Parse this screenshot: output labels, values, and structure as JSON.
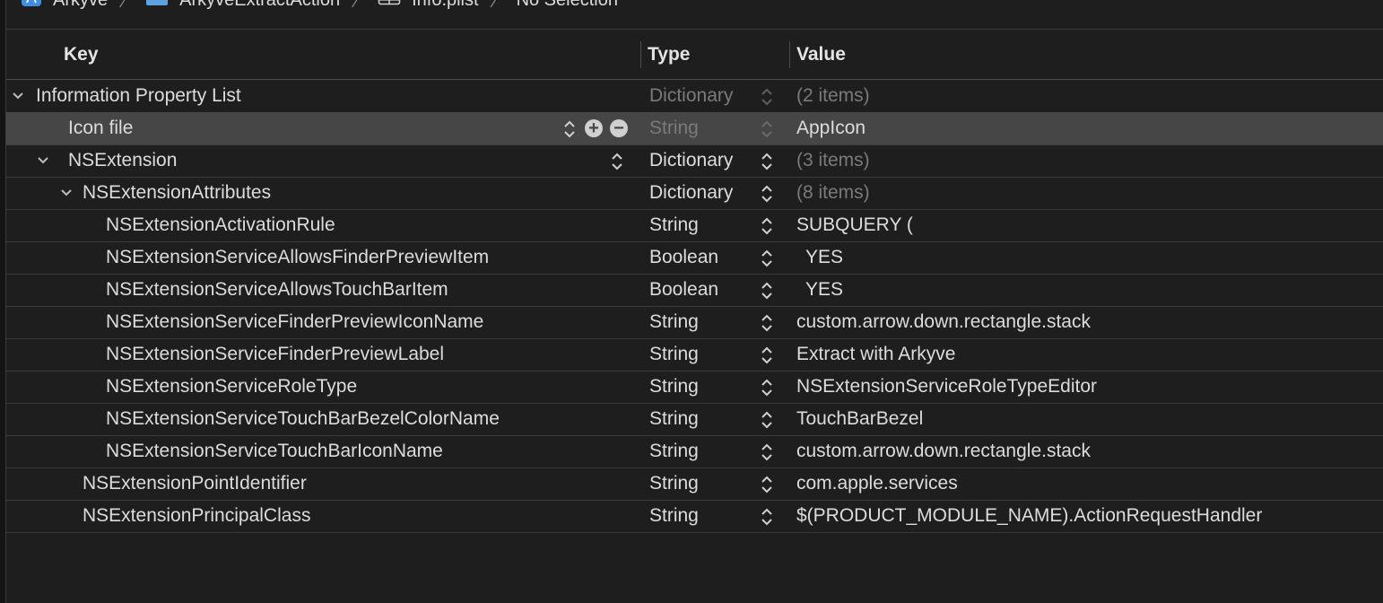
{
  "breadcrumb": {
    "items": [
      {
        "label": "Arkyve",
        "icon": "xcode-project-icon"
      },
      {
        "label": "ArkyveExtractAction",
        "icon": "folder-icon"
      },
      {
        "label": "Info.plist",
        "icon": "plist-table-icon"
      },
      {
        "label": "No Selection",
        "icon": null
      }
    ]
  },
  "header": {
    "key": "Key",
    "type": "Type",
    "value": "Value"
  },
  "rows": [
    {
      "key": "Information Property List",
      "type": "Dictionary",
      "value": "(2 items)"
    },
    {
      "key": "Icon file",
      "type": "String",
      "value": "AppIcon"
    },
    {
      "key": "NSExtension",
      "type": "Dictionary",
      "value": "(3 items)"
    },
    {
      "key": "NSExtensionAttributes",
      "type": "Dictionary",
      "value": "(8 items)"
    },
    {
      "key": "NSExtensionActivationRule",
      "type": "String",
      "value": "SUBQUERY ("
    },
    {
      "key": "NSExtensionServiceAllowsFinderPreviewItem",
      "type": "Boolean",
      "value": "YES"
    },
    {
      "key": "NSExtensionServiceAllowsTouchBarItem",
      "type": "Boolean",
      "value": "YES"
    },
    {
      "key": "NSExtensionServiceFinderPreviewIconName",
      "type": "String",
      "value": "custom.arrow.down.rectangle.stack"
    },
    {
      "key": "NSExtensionServiceFinderPreviewLabel",
      "type": "String",
      "value": "Extract with Arkyve"
    },
    {
      "key": "NSExtensionServiceRoleType",
      "type": "String",
      "value": "NSExtensionServiceRoleTypeEditor"
    },
    {
      "key": "NSExtensionServiceTouchBarBezelColorName",
      "type": "String",
      "value": "TouchBarBezel"
    },
    {
      "key": "NSExtensionServiceTouchBarIconName",
      "type": "String",
      "value": "custom.arrow.down.rectangle.stack"
    },
    {
      "key": "NSExtensionPointIdentifier",
      "type": "String",
      "value": "com.apple.services"
    },
    {
      "key": "NSExtensionPrincipalClass",
      "type": "String",
      "value": "$(PRODUCT_MODULE_NAME).ActionRequestHandler"
    }
  ],
  "colors": {
    "background": "#1e1e1e",
    "selected_row": "#464646",
    "text": "#dcdcdc",
    "dim_text": "#7a7a7a",
    "accent_blue": "#3d8ee6"
  }
}
